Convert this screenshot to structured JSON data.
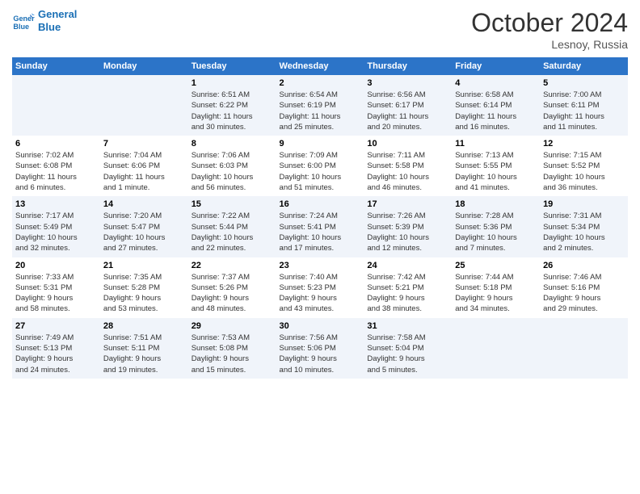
{
  "logo": {
    "line1": "General",
    "line2": "Blue"
  },
  "title": "October 2024",
  "location": "Lesnoy, Russia",
  "weekdays": [
    "Sunday",
    "Monday",
    "Tuesday",
    "Wednesday",
    "Thursday",
    "Friday",
    "Saturday"
  ],
  "weeks": [
    [
      {
        "day": "",
        "content": ""
      },
      {
        "day": "",
        "content": ""
      },
      {
        "day": "1",
        "content": "Sunrise: 6:51 AM\nSunset: 6:22 PM\nDaylight: 11 hours\nand 30 minutes."
      },
      {
        "day": "2",
        "content": "Sunrise: 6:54 AM\nSunset: 6:19 PM\nDaylight: 11 hours\nand 25 minutes."
      },
      {
        "day": "3",
        "content": "Sunrise: 6:56 AM\nSunset: 6:17 PM\nDaylight: 11 hours\nand 20 minutes."
      },
      {
        "day": "4",
        "content": "Sunrise: 6:58 AM\nSunset: 6:14 PM\nDaylight: 11 hours\nand 16 minutes."
      },
      {
        "day": "5",
        "content": "Sunrise: 7:00 AM\nSunset: 6:11 PM\nDaylight: 11 hours\nand 11 minutes."
      }
    ],
    [
      {
        "day": "6",
        "content": "Sunrise: 7:02 AM\nSunset: 6:08 PM\nDaylight: 11 hours\nand 6 minutes."
      },
      {
        "day": "7",
        "content": "Sunrise: 7:04 AM\nSunset: 6:06 PM\nDaylight: 11 hours\nand 1 minute."
      },
      {
        "day": "8",
        "content": "Sunrise: 7:06 AM\nSunset: 6:03 PM\nDaylight: 10 hours\nand 56 minutes."
      },
      {
        "day": "9",
        "content": "Sunrise: 7:09 AM\nSunset: 6:00 PM\nDaylight: 10 hours\nand 51 minutes."
      },
      {
        "day": "10",
        "content": "Sunrise: 7:11 AM\nSunset: 5:58 PM\nDaylight: 10 hours\nand 46 minutes."
      },
      {
        "day": "11",
        "content": "Sunrise: 7:13 AM\nSunset: 5:55 PM\nDaylight: 10 hours\nand 41 minutes."
      },
      {
        "day": "12",
        "content": "Sunrise: 7:15 AM\nSunset: 5:52 PM\nDaylight: 10 hours\nand 36 minutes."
      }
    ],
    [
      {
        "day": "13",
        "content": "Sunrise: 7:17 AM\nSunset: 5:49 PM\nDaylight: 10 hours\nand 32 minutes."
      },
      {
        "day": "14",
        "content": "Sunrise: 7:20 AM\nSunset: 5:47 PM\nDaylight: 10 hours\nand 27 minutes."
      },
      {
        "day": "15",
        "content": "Sunrise: 7:22 AM\nSunset: 5:44 PM\nDaylight: 10 hours\nand 22 minutes."
      },
      {
        "day": "16",
        "content": "Sunrise: 7:24 AM\nSunset: 5:41 PM\nDaylight: 10 hours\nand 17 minutes."
      },
      {
        "day": "17",
        "content": "Sunrise: 7:26 AM\nSunset: 5:39 PM\nDaylight: 10 hours\nand 12 minutes."
      },
      {
        "day": "18",
        "content": "Sunrise: 7:28 AM\nSunset: 5:36 PM\nDaylight: 10 hours\nand 7 minutes."
      },
      {
        "day": "19",
        "content": "Sunrise: 7:31 AM\nSunset: 5:34 PM\nDaylight: 10 hours\nand 2 minutes."
      }
    ],
    [
      {
        "day": "20",
        "content": "Sunrise: 7:33 AM\nSunset: 5:31 PM\nDaylight: 9 hours\nand 58 minutes."
      },
      {
        "day": "21",
        "content": "Sunrise: 7:35 AM\nSunset: 5:28 PM\nDaylight: 9 hours\nand 53 minutes."
      },
      {
        "day": "22",
        "content": "Sunrise: 7:37 AM\nSunset: 5:26 PM\nDaylight: 9 hours\nand 48 minutes."
      },
      {
        "day": "23",
        "content": "Sunrise: 7:40 AM\nSunset: 5:23 PM\nDaylight: 9 hours\nand 43 minutes."
      },
      {
        "day": "24",
        "content": "Sunrise: 7:42 AM\nSunset: 5:21 PM\nDaylight: 9 hours\nand 38 minutes."
      },
      {
        "day": "25",
        "content": "Sunrise: 7:44 AM\nSunset: 5:18 PM\nDaylight: 9 hours\nand 34 minutes."
      },
      {
        "day": "26",
        "content": "Sunrise: 7:46 AM\nSunset: 5:16 PM\nDaylight: 9 hours\nand 29 minutes."
      }
    ],
    [
      {
        "day": "27",
        "content": "Sunrise: 7:49 AM\nSunset: 5:13 PM\nDaylight: 9 hours\nand 24 minutes."
      },
      {
        "day": "28",
        "content": "Sunrise: 7:51 AM\nSunset: 5:11 PM\nDaylight: 9 hours\nand 19 minutes."
      },
      {
        "day": "29",
        "content": "Sunrise: 7:53 AM\nSunset: 5:08 PM\nDaylight: 9 hours\nand 15 minutes."
      },
      {
        "day": "30",
        "content": "Sunrise: 7:56 AM\nSunset: 5:06 PM\nDaylight: 9 hours\nand 10 minutes."
      },
      {
        "day": "31",
        "content": "Sunrise: 7:58 AM\nSunset: 5:04 PM\nDaylight: 9 hours\nand 5 minutes."
      },
      {
        "day": "",
        "content": ""
      },
      {
        "day": "",
        "content": ""
      }
    ]
  ]
}
